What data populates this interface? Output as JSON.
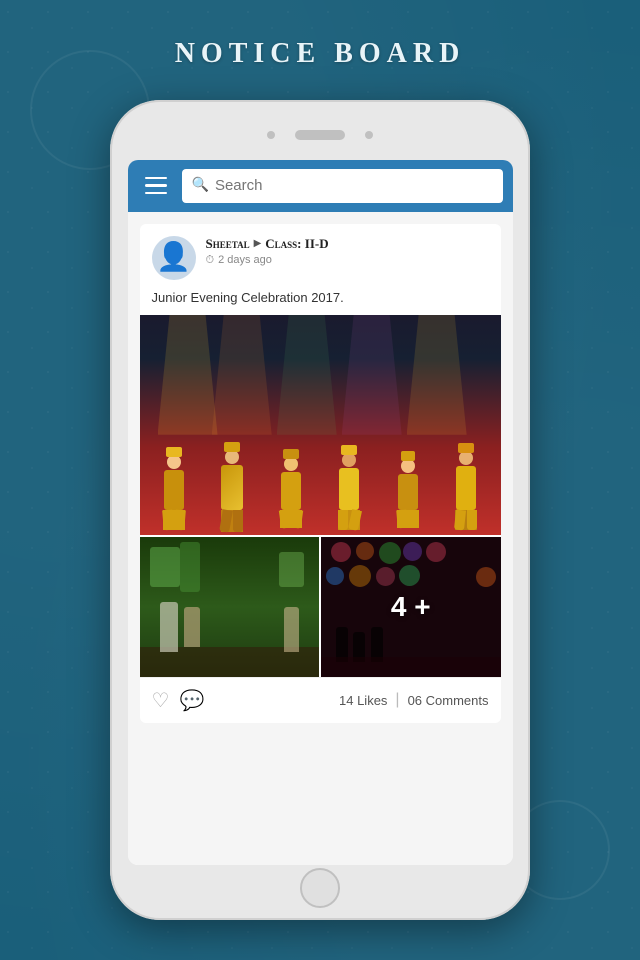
{
  "page": {
    "title": "NOTICE BOARD"
  },
  "toolbar": {
    "search_placeholder": "Search"
  },
  "post": {
    "author": "Sheetal",
    "class": "Class: II-D",
    "time": "2 days ago",
    "caption": "Junior Evening Celebration 2017.",
    "likes": "14 Likes",
    "comments": "06 Comments",
    "more_count": "4 +"
  },
  "icons": {
    "menu": "☰",
    "search": "🔍",
    "heart": "♡",
    "comment": "💬",
    "clock": "⏱",
    "arrow": "▶",
    "person": "👤"
  }
}
